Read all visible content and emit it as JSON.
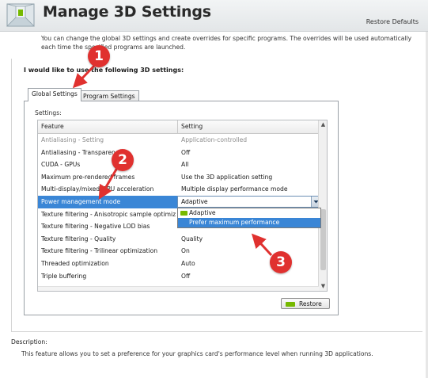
{
  "header": {
    "title": "Manage 3D Settings",
    "restore_defaults": "Restore Defaults"
  },
  "intro": "You can change the global 3D settings and create overrides for specific programs. The overrides will be used automatically each time the specified programs are launched.",
  "group_heading": "I would like to use the following 3D settings:",
  "tabs": [
    {
      "label": "Global Settings",
      "active": true
    },
    {
      "label": "Program Settings",
      "active": false
    }
  ],
  "settings_label": "Settings:",
  "columns": {
    "feature": "Feature",
    "setting": "Setting"
  },
  "rows": [
    {
      "feature": "Antialiasing - Setting",
      "setting": "Application-controlled",
      "dim": true
    },
    {
      "feature": "Antialiasing - Transparency",
      "setting": "Off"
    },
    {
      "feature": "CUDA - GPUs",
      "setting": "All"
    },
    {
      "feature": "Maximum pre-rendered frames",
      "setting": "Use the 3D application setting"
    },
    {
      "feature": "Multi-display/mixed-GPU acceleration",
      "setting": "Multiple display performance mode"
    },
    {
      "feature": "Power management mode",
      "setting": "Adaptive",
      "selected": true
    },
    {
      "feature": "Texture filtering - Anisotropic sample optimization",
      "setting": ""
    },
    {
      "feature": "Texture filtering - Negative LOD bias",
      "setting": ""
    },
    {
      "feature": "Texture filtering - Quality",
      "setting": "Quality"
    },
    {
      "feature": "Texture filtering - Trilinear optimization",
      "setting": "On"
    },
    {
      "feature": "Threaded optimization",
      "setting": "Auto"
    },
    {
      "feature": "Triple buffering",
      "setting": "Off"
    }
  ],
  "dropdown": {
    "selected": "Adaptive",
    "options": [
      "Adaptive",
      "Prefer maximum performance"
    ],
    "highlighted": "Prefer maximum performance"
  },
  "restore_button": "Restore",
  "description": {
    "label": "Description:",
    "text": "This feature allows you to set a preference for your graphics card's performance level when running 3D applications."
  },
  "annotations": [
    "1",
    "2",
    "3"
  ],
  "colors": {
    "selection": "#3a86d6",
    "nvidia_green": "#76b900",
    "annotation_red": "#e0312f"
  }
}
